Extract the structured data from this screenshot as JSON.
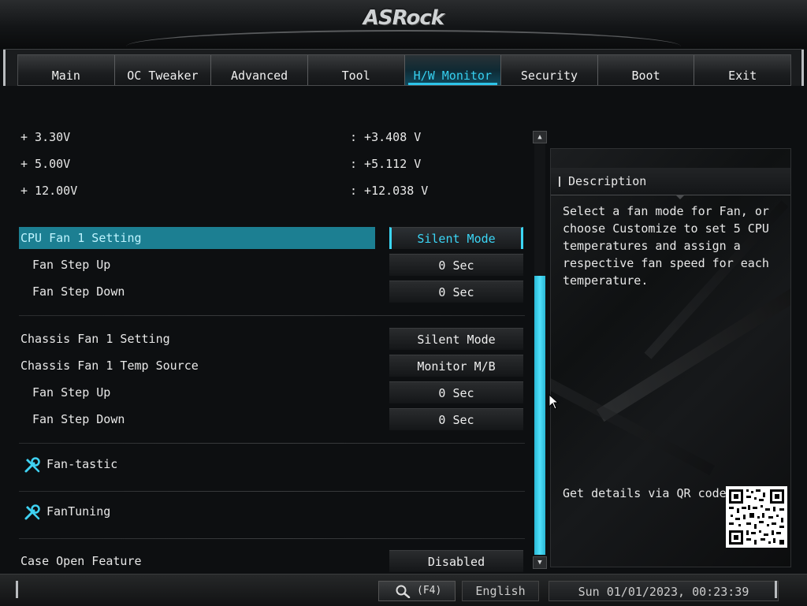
{
  "brand": {
    "logo_text": "ASRock"
  },
  "tabs": [
    {
      "label": "Main",
      "active": false
    },
    {
      "label": "OC Tweaker",
      "active": false
    },
    {
      "label": "Advanced",
      "active": false
    },
    {
      "label": "Tool",
      "active": false
    },
    {
      "label": "H/W Monitor",
      "active": true
    },
    {
      "label": "Security",
      "active": false
    },
    {
      "label": "Boot",
      "active": false
    },
    {
      "label": "Exit",
      "active": false
    }
  ],
  "voltages": [
    {
      "label": "+ 3.30V",
      "value": ": +3.408 V"
    },
    {
      "label": "+ 5.00V",
      "value": ": +5.112 V"
    },
    {
      "label": "+ 12.00V",
      "value": ": +12.038 V"
    }
  ],
  "cpu_fan": {
    "setting": {
      "label": "CPU Fan 1 Setting",
      "value": "Silent Mode"
    },
    "step_up": {
      "label": "Fan Step Up",
      "value": "0 Sec"
    },
    "step_down": {
      "label": "Fan Step Down",
      "value": "0 Sec"
    }
  },
  "chassis_fan": {
    "setting": {
      "label": "Chassis Fan 1 Setting",
      "value": "Silent Mode"
    },
    "temp_source": {
      "label": "Chassis Fan 1 Temp Source",
      "value": "Monitor M/B"
    },
    "step_up": {
      "label": "Fan Step Up",
      "value": "0 Sec"
    },
    "step_down": {
      "label": "Fan Step Down",
      "value": "0 Sec"
    }
  },
  "tools": {
    "fan_tastic": "Fan-tastic",
    "fan_tuning": "FanTuning"
  },
  "case_open": {
    "label": "Case Open Feature",
    "value": "Disabled"
  },
  "description": {
    "title": "Description",
    "text": "Select a fan mode for Fan, or\nchoose Customize to set 5 CPU\ntemperatures and assign a\nrespective fan speed for each\ntemperature.",
    "qr_label": "Get details via QR code"
  },
  "footer": {
    "search_key": "(F4)",
    "language": "English",
    "datetime": "Sun 01/01/2023, 00:23:39"
  },
  "colors": {
    "accent": "#2ec4ea",
    "selected_row": "#1c7f92",
    "background": "#0d0f11"
  },
  "icons": [
    "search-icon",
    "wrench-screwdriver-icon",
    "scroll-up-arrow-icon",
    "scroll-down-arrow-icon",
    "qr-code-icon",
    "mouse-cursor-icon"
  ]
}
